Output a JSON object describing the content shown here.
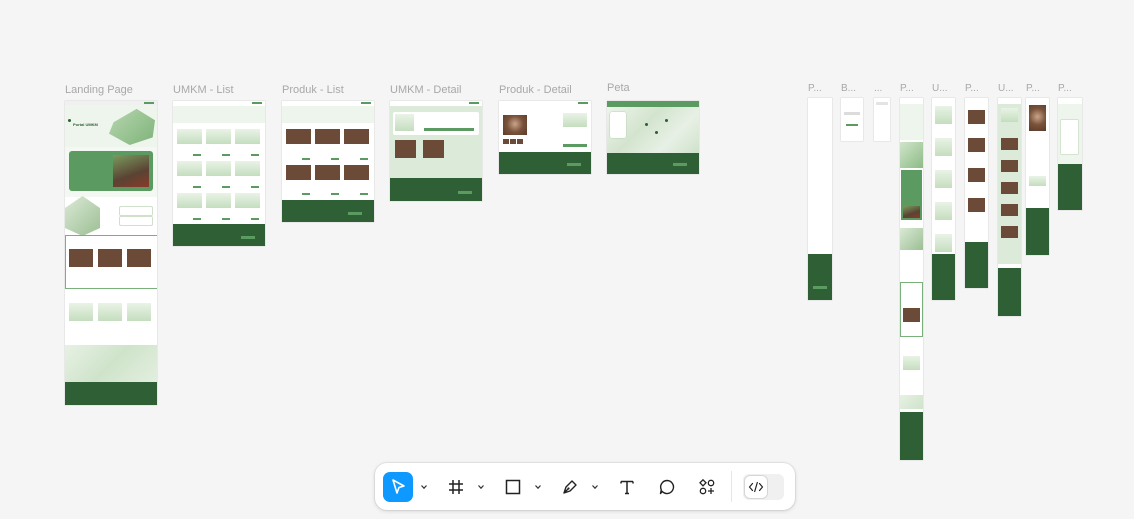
{
  "frames": {
    "landing": "Landing Page",
    "umkm_list": "UMKM - List",
    "produk_list": "Produk - List",
    "umkm_detail": "UMKM - Detail",
    "produk_detail": "Produk - Detail",
    "peta": "Peta",
    "m1": "P...",
    "m2": "B...",
    "m3": "...",
    "m4": "P...",
    "m5": "U...",
    "m6": "P...",
    "m7": "U...",
    "m8": "P...",
    "m9": "P..."
  },
  "landing_hero": {
    "title": "Portal UMKM"
  },
  "toolbar": {
    "tools": [
      "move-tool",
      "frame-tool",
      "rectangle-tool",
      "pen-tool",
      "text-tool",
      "comment-tool",
      "actions-tool"
    ],
    "active_tool": "move-tool",
    "code_icon": "</>"
  },
  "colors": {
    "brand_dark": "#2f5f35",
    "brand_mid": "#5b9b62",
    "brand_light": "#dcebd9",
    "canvas": "#f5f5f5",
    "accent": "#0d99ff"
  }
}
